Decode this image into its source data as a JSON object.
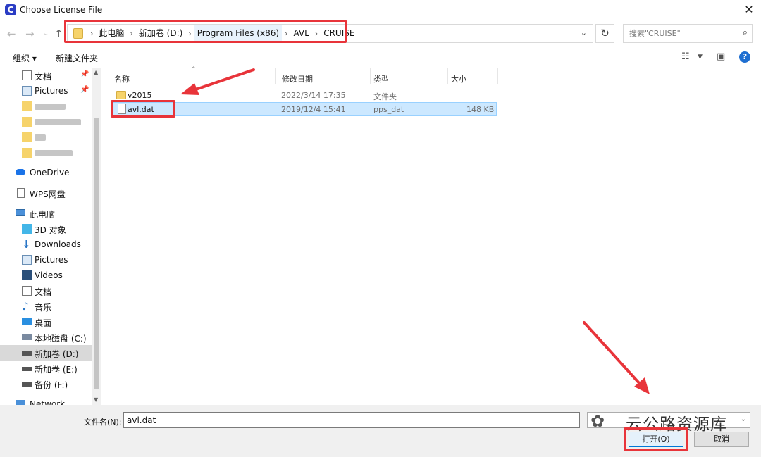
{
  "window": {
    "title": "Choose License File",
    "app_icon_letter": "C"
  },
  "breadcrumbs": [
    "此电脑",
    "新加卷 (D:)",
    "Program Files (x86)",
    "AVL",
    "CRUISE"
  ],
  "search": {
    "placeholder": "搜索\"CRUISE\""
  },
  "toolbar": {
    "organize_label": "组织 ▾",
    "new_folder_label": "新建文件夹"
  },
  "sidebar": {
    "quick_access": [
      {
        "label": "文档",
        "pinned": true
      },
      {
        "label": "Pictures",
        "pinned": true
      }
    ],
    "onedrive": "OneDrive",
    "wps": "WPS网盘",
    "this_pc": "此电脑",
    "pc_items": [
      "3D 对象",
      "Downloads",
      "Pictures",
      "Videos",
      "文档",
      "音乐",
      "桌面",
      "本地磁盘 (C:)",
      "新加卷 (D:)",
      "新加卷 (E:)",
      "备份 (F:)"
    ],
    "network": "Network",
    "selected_item": "新加卷 (D:)"
  },
  "columns": {
    "name": "名称",
    "modified": "修改日期",
    "type": "类型",
    "size": "大小"
  },
  "files": [
    {
      "name": "v2015",
      "modified": "2022/3/14 17:35",
      "type": "文件夹",
      "size": "",
      "kind": "folder"
    },
    {
      "name": "avl.dat",
      "modified": "2019/12/4 15:41",
      "type": "pps_dat",
      "size": "148 KB",
      "kind": "file",
      "selected": true
    }
  ],
  "bottom": {
    "filename_label": "文件名(N):",
    "filename_value": "avl.dat",
    "open_label": "打开(O)",
    "cancel_label": "取消"
  },
  "watermark": {
    "text": "云公路资源库"
  },
  "colors": {
    "accent": "#0078d7",
    "annotation_red": "#e8343a",
    "selection": "#cce8ff",
    "folder": "#f6d36b"
  }
}
